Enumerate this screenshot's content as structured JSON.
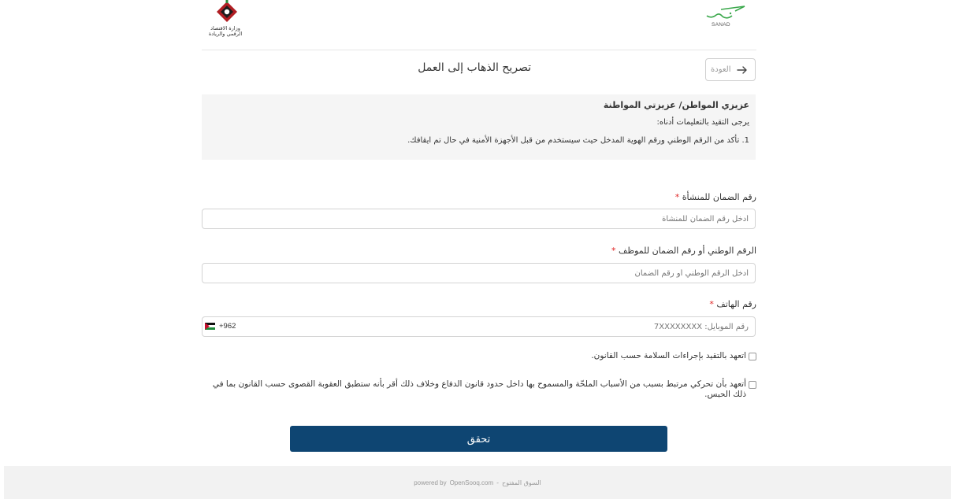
{
  "header": {
    "brand_text": "SANAD",
    "ministry_name": "وزارة الاقتصاد الرقمي والريادة"
  },
  "titlebar": {
    "back_label": "العودة",
    "title": "تصريح الذهاب إلى العمل"
  },
  "notice": {
    "heading": "عزيزي المواطن/ عزيزتي المواطنة",
    "subheading": "يرجى التقيد بالتعليمات أدناه:",
    "items": [
      "1. تأكد من الرقم الوطني ورقم الهوية المدخل حيث سيستخدم من قبل الأجهزة الأمنية في حال تم ايقافك."
    ]
  },
  "form": {
    "establishment": {
      "label": "رقم الضمان للمنشأة",
      "required_mark": "*",
      "value": "",
      "placeholder": "أدخل رقم الضمان للمنشأة"
    },
    "employee": {
      "label": "الرقم الوطني أو رقم الضمان للموظف",
      "required_mark": "*",
      "value": "",
      "placeholder": "أدخل الرقم الوطني أو رقم الضمان"
    },
    "phone": {
      "label": "رقم الهاتف",
      "required_mark": "*",
      "value": "",
      "placeholder": "رقم الموبايل: 7XXXXXXXX",
      "country_code": "+962",
      "country_flag": "jordan-flag-icon"
    },
    "checkbox_safety": {
      "label": "اتعهد بالتقيد بإجراءات السلامة حسب القانون.",
      "checked": false
    },
    "checkbox_pledge": {
      "label": "أتعهد بأن تحركي مرتبط بسبب من الأسباب الملحّة والمسموح بها داخل حدود قانون الدفاع وخلاف ذلك أقر بأنه ستطبق العقوبة القصوى حسب القانون بما في ذلك الحبس.",
      "checked": false
    },
    "submit_label": "تحقق"
  },
  "footer": {
    "powered_by": "powered by",
    "brand": "OpenSooq.com",
    "separator": "-",
    "brand_ar": "السوق المفتوح"
  },
  "colors": {
    "primary_button": "#0e4572",
    "required": "#e02424",
    "sanad_accent": "#3aa84b",
    "ministry_red": "#b01e23"
  }
}
